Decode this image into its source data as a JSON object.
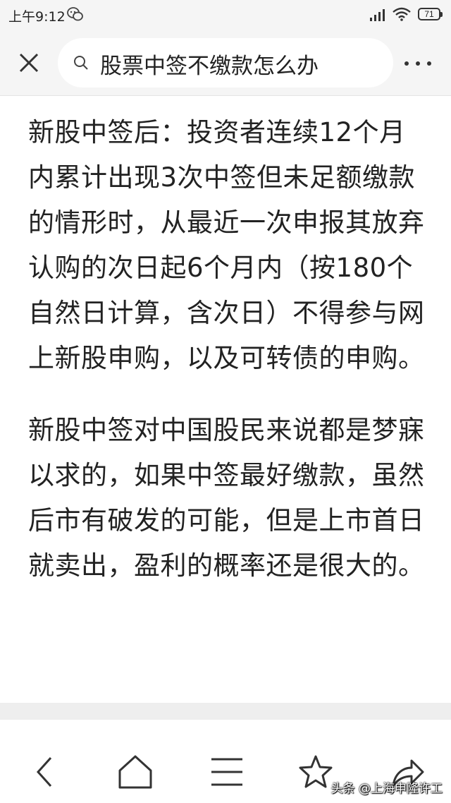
{
  "status_bar": {
    "time": "上午9:12",
    "battery": "71",
    "icons": [
      "wechat-icon",
      "signal-icon",
      "wifi-icon",
      "battery-icon"
    ]
  },
  "header": {
    "search_query": "股票中签不缴款怎么办",
    "icons": [
      "close-icon",
      "search-icon",
      "more-icon"
    ]
  },
  "article": {
    "paragraphs": [
      "新股中签后：投资者连续12个月内累计出现3次中签但未足额缴款的情形时，从最近一次申报其放弃认购的次日起6个月内（按180个自然日计算，含次日）不得参与网上新股申购，以及可转债的申购。",
      "新股中签对中国股民来说都是梦寐以求的，如果中签最好缴款，虽然后市有破发的可能，但是上市首日就卖出，盈利的概率还是很大的。"
    ]
  },
  "bottom_nav": {
    "icons": [
      "back-icon",
      "home-icon",
      "menu-icon",
      "star-icon",
      "share-icon"
    ]
  },
  "watermark": "头条 @上海申隆许工"
}
